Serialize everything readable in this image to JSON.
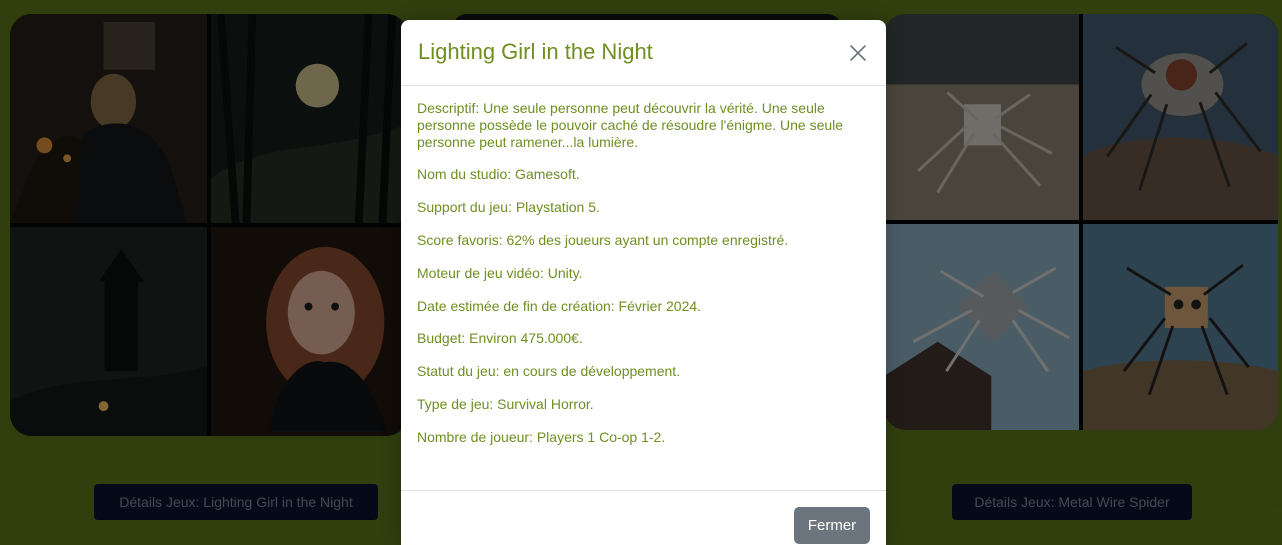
{
  "games": [
    {
      "button_label": "Détails Jeux: Lighting Girl in the Night"
    },
    {
      "button_label": "Détails Jeux: Metal Wire Spider"
    }
  ],
  "modal": {
    "title": "Lighting Girl in the Night",
    "close_icon": "close-icon",
    "details": [
      "Descriptif: Une seule personne peut découvrir la vérité. Une seule personne possède le pouvoir caché de résoudre l'énigme. Une seule personne peut ramener...la lumière.",
      "Nom du studio: Gamesoft.",
      "Support du jeu: Playstation 5.",
      "Score favoris: 62% des joueurs ayant un compte enregistré.",
      "Moteur de jeu vidéo: Unity.",
      "Date estimée de fin de création: Février 2024.",
      "Budget: Environ 475.000€.",
      "Statut du jeu: en cours de développement.",
      "Type de jeu: Survival Horror.",
      "Nombre de joueur: Players 1 Co-op 1-2."
    ],
    "footer_button": "Fermer"
  },
  "colors": {
    "page_background": "#5e7a1b",
    "modal_text": "#6f8f22",
    "game_button_background": "#08152f",
    "secondary_button": "#6c757d"
  }
}
